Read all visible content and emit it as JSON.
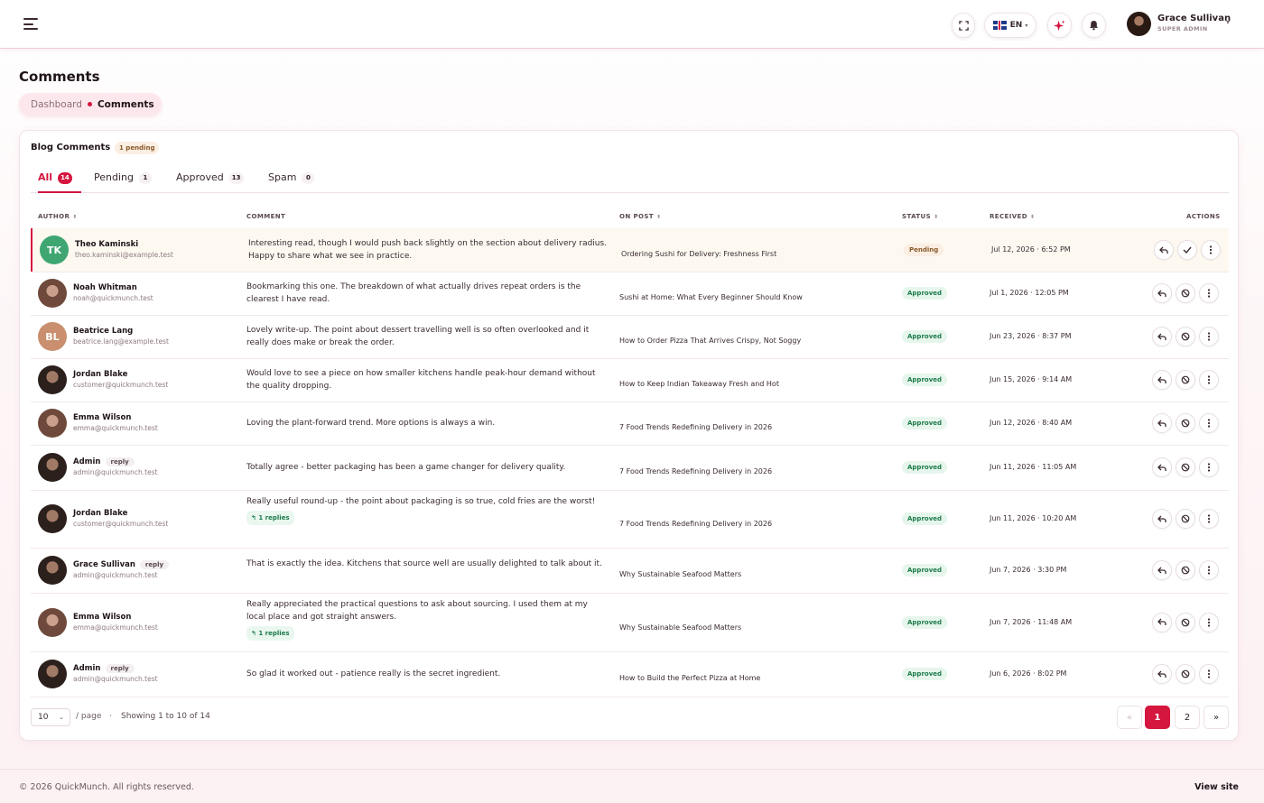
{
  "header": {
    "language": "EN",
    "user_name": "Grace Sullivan",
    "user_role": "SUPER ADMIN"
  },
  "page": {
    "title": "Comments",
    "breadcrumb": [
      "Dashboard",
      "Comments"
    ]
  },
  "card": {
    "title": "Blog Comments",
    "pending_badge": "1 pending",
    "tabs": [
      {
        "label": "All",
        "count": "14"
      },
      {
        "label": "Pending",
        "count": "1"
      },
      {
        "label": "Approved",
        "count": "13"
      },
      {
        "label": "Spam",
        "count": "0"
      }
    ],
    "columns": [
      "AUTHOR",
      "COMMENT",
      "ON POST",
      "STATUS",
      "RECEIVED",
      "ACTIONS"
    ],
    "rows": [
      {
        "initials": "TK",
        "name": "Theo Kaminski",
        "tag": "",
        "email": "theo.kaminski@example.test",
        "comment": "Interesting read, though I would push back slightly on the section about delivery radius. Happy to share what we see in practice.",
        "replies": "",
        "post": "Ordering Sushi for Delivery: Freshness First",
        "status": "Pending",
        "received": "Jul 12, 2026 · 6:52 PM"
      },
      {
        "initials": "",
        "name": "Noah Whitman",
        "tag": "",
        "email": "noah@quickmunch.test",
        "comment": "Bookmarking this one. The breakdown of what actually drives repeat orders is the clearest I have read.",
        "replies": "",
        "post": "Sushi at Home: What Every Beginner Should Know",
        "status": "Approved",
        "received": "Jul 1, 2026 · 12:05 PM"
      },
      {
        "initials": "BL",
        "name": "Beatrice Lang",
        "tag": "",
        "email": "beatrice.lang@example.test",
        "comment": "Lovely write-up. The point about dessert travelling well is so often overlooked and it really does make or break the order.",
        "replies": "",
        "post": "How to Order Pizza That Arrives Crispy, Not Soggy",
        "status": "Approved",
        "received": "Jun 23, 2026 · 8:37 PM"
      },
      {
        "initials": "",
        "name": "Jordan Blake",
        "tag": "",
        "email": "customer@quickmunch.test",
        "comment": "Would love to see a piece on how smaller kitchens handle peak-hour demand without the quality dropping.",
        "replies": "",
        "post": "How to Keep Indian Takeaway Fresh and Hot",
        "status": "Approved",
        "received": "Jun 15, 2026 · 9:14 AM"
      },
      {
        "initials": "",
        "name": "Emma Wilson",
        "tag": "",
        "email": "emma@quickmunch.test",
        "comment": "Loving the plant-forward trend. More options is always a win.",
        "replies": "",
        "post": "7 Food Trends Redefining Delivery in 2026",
        "status": "Approved",
        "received": "Jun 12, 2026 · 8:40 AM"
      },
      {
        "initials": "",
        "name": "Admin",
        "tag": "reply",
        "email": "admin@quickmunch.test",
        "comment": "Totally agree - better packaging has been a game changer for delivery quality.",
        "replies": "",
        "post": "7 Food Trends Redefining Delivery in 2026",
        "status": "Approved",
        "received": "Jun 11, 2026 · 11:05 AM"
      },
      {
        "initials": "",
        "name": "Jordan Blake",
        "tag": "",
        "email": "customer@quickmunch.test",
        "comment": "Really useful round-up - the point about packaging is so true, cold fries are the worst!",
        "replies": "1 replies",
        "post": "7 Food Trends Redefining Delivery in 2026",
        "status": "Approved",
        "received": "Jun 11, 2026 · 10:20 AM"
      },
      {
        "initials": "",
        "name": "Grace Sullivan",
        "tag": "reply",
        "email": "admin@quickmunch.test",
        "comment": "That is exactly the idea. Kitchens that source well are usually delighted to talk about it.",
        "replies": "",
        "post": "Why Sustainable Seafood Matters",
        "status": "Approved",
        "received": "Jun 7, 2026 · 3:30 PM"
      },
      {
        "initials": "",
        "name": "Emma Wilson",
        "tag": "",
        "email": "emma@quickmunch.test",
        "comment": "Really appreciated the practical questions to ask about sourcing. I used them at my local place and got straight answers.",
        "replies": "1 replies",
        "post": "Why Sustainable Seafood Matters",
        "status": "Approved",
        "received": "Jun 7, 2026 · 11:48 AM"
      },
      {
        "initials": "",
        "name": "Admin",
        "tag": "reply",
        "email": "admin@quickmunch.test",
        "comment": "So glad it worked out - patience really is the secret ingredient.",
        "replies": "",
        "post": "How to Build the Perfect Pizza at Home",
        "status": "Approved",
        "received": "Jun 6, 2026 · 8:02 PM"
      }
    ]
  },
  "pagination": {
    "per_page": "10",
    "per_page_suffix": "/ page",
    "showing": "Showing 1 to 10 of 14",
    "prev": "«",
    "pages": [
      "1",
      "2"
    ],
    "next": "»"
  },
  "footer": {
    "copyright": "© 2026 QuickMunch. All rights reserved.",
    "view_site": "View site"
  },
  "colors": {
    "accent": "#d5163f",
    "approved_bg": "#e6f6ec",
    "pending_bg": "#fbeee2",
    "avatar_tk": "#3fa672",
    "avatar_bl": "#c98f6e"
  }
}
